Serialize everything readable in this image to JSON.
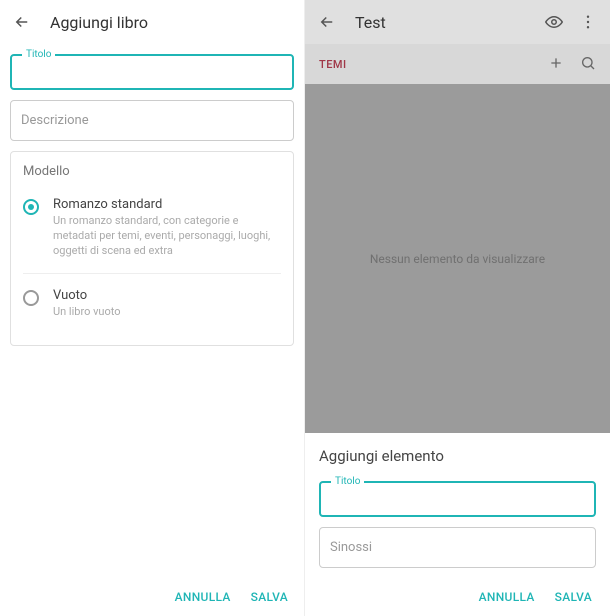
{
  "left": {
    "appbar": {
      "title": "Aggiungi libro"
    },
    "title_field": {
      "label": "Titolo"
    },
    "desc_field": {
      "placeholder": "Descrizione"
    },
    "model_card": {
      "heading": "Modello",
      "options": [
        {
          "title": "Romanzo standard",
          "desc": "Un romanzo standard, con categorie e metadati per temi, eventi, personaggi, luoghi, oggetti di scena ed extra"
        },
        {
          "title": "Vuoto",
          "desc": "Un libro vuoto"
        }
      ]
    },
    "footer": {
      "cancel": "ANNULLA",
      "save": "SALVA"
    }
  },
  "right": {
    "appbar": {
      "title": "Test"
    },
    "themes": {
      "label": "TEMI"
    },
    "empty": "Nessun elemento da visualizzare",
    "sheet": {
      "title": "Aggiungi elemento",
      "title_field": {
        "label": "Titolo"
      },
      "synopsis_field": {
        "placeholder": "Sinossi"
      }
    },
    "footer": {
      "cancel": "ANNULLA",
      "save": "SALVA"
    }
  }
}
